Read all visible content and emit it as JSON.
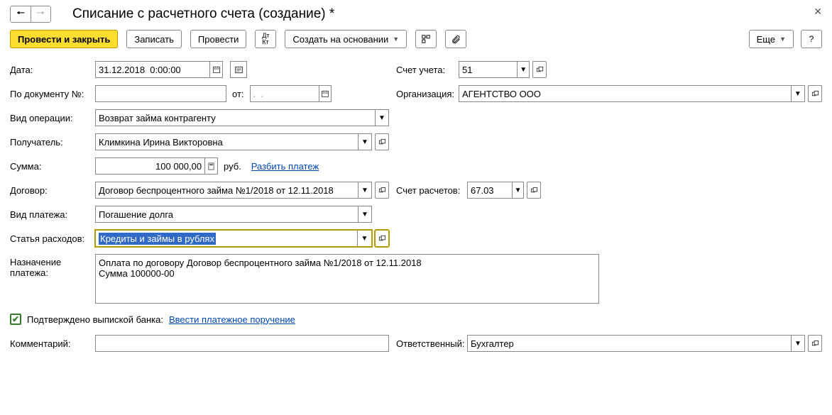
{
  "title": "Списание с расчетного счета (создание) *",
  "toolbar": {
    "post_close": "Провести и закрыть",
    "write": "Записать",
    "post": "Провести",
    "dk": "Дт\nКт",
    "based_on": "Создать на основании",
    "more": "Еще",
    "help": "?"
  },
  "labels": {
    "date": "Дата:",
    "account": "Счет учета:",
    "docnum": "По документу №:",
    "from": "от:",
    "org": "Организация:",
    "op_kind": "Вид операции:",
    "payee": "Получатель:",
    "sum": "Сумма:",
    "currency": "руб.",
    "split": "Разбить платеж",
    "contract": "Договор:",
    "settle_acc": "Счет расчетов:",
    "pay_kind": "Вид платежа:",
    "exp_item": "Статья расходов:",
    "purpose": "Назначение платежа:",
    "confirmed": "Подтверждено выпиской банка:",
    "enter_order": "Ввести платежное поручение",
    "comment": "Комментарий:",
    "responsible": "Ответственный:",
    "date_tpl": ".  ."
  },
  "values": {
    "date": "31.12.2018  0:00:00",
    "account": "51",
    "org": "АГЕНТСТВО ООО",
    "op_kind": "Возврат займа контрагенту",
    "payee": "Климкина Ирина Викторовна",
    "sum": "100 000,00",
    "contract": "Договор беспроцентного займа №1/2018 от 12.11.2018",
    "settle_acc": "67.03",
    "pay_kind": "Погашение долга",
    "exp_item": "Кредиты и займы в рублях",
    "purpose": "Оплата по договору Договор беспроцентного займа №1/2018 от 12.11.2018\nСумма 100000-00",
    "responsible": "Бухгалтер",
    "comment": "",
    "docnum": ""
  }
}
